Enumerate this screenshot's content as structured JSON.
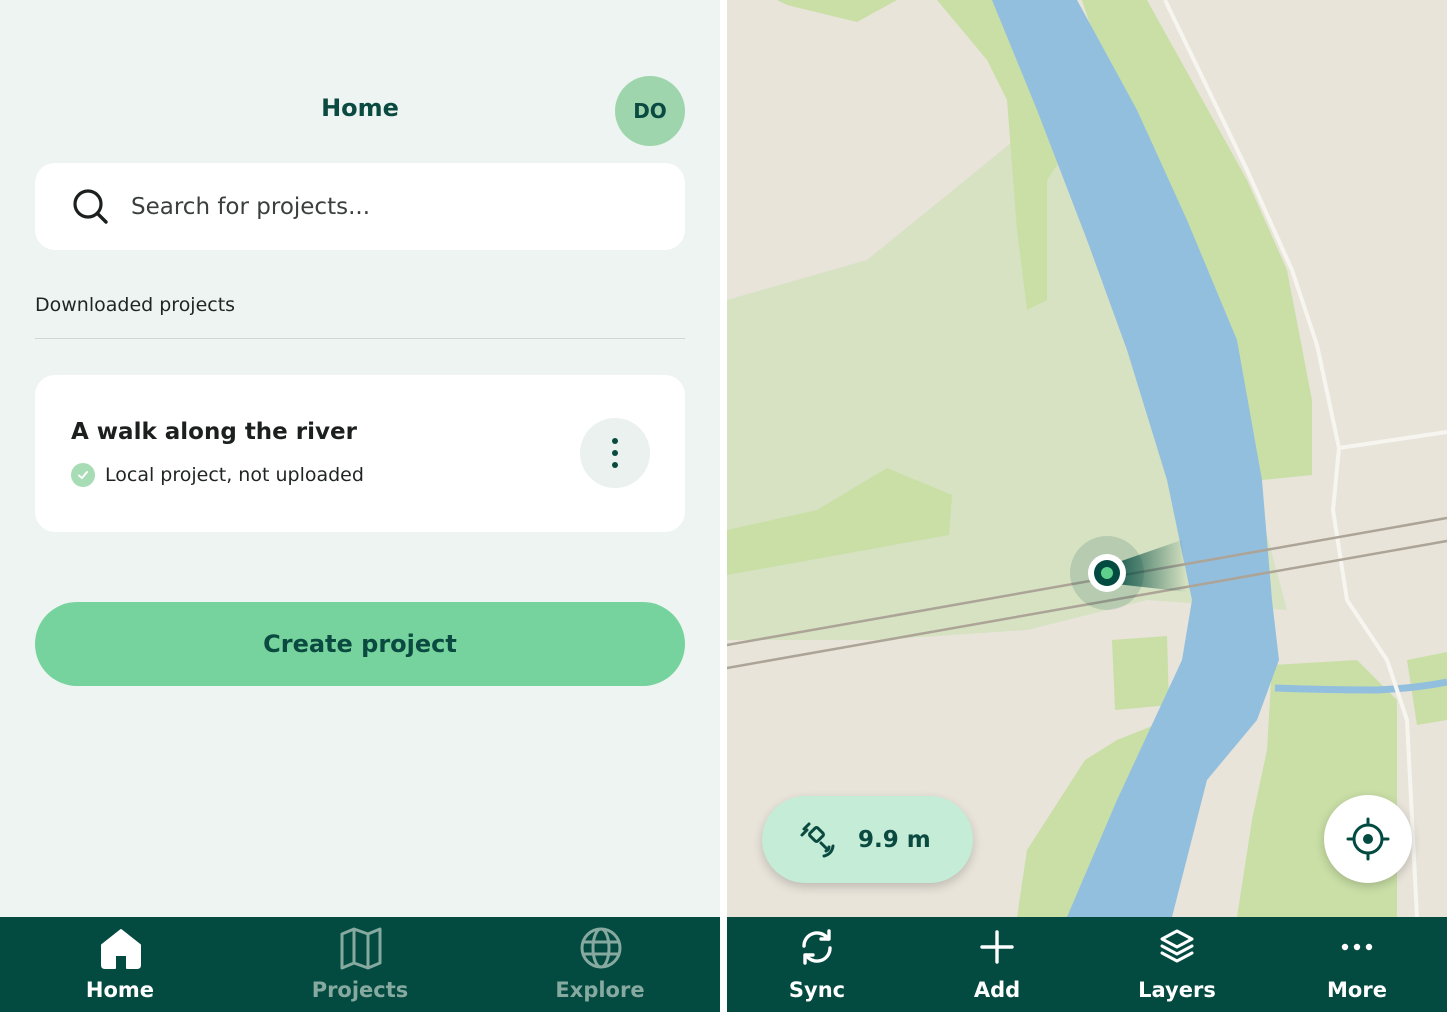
{
  "home": {
    "title": "Home",
    "avatar_initials": "DO",
    "search": {
      "placeholder": "Search for projects..."
    },
    "section_label": "Downloaded projects",
    "projects": [
      {
        "name": "A walk along the river",
        "status": "Local project, not uploaded",
        "status_icon": "check-circle-icon"
      }
    ],
    "create_button": "Create project",
    "nav": [
      {
        "label": "Home",
        "icon": "home-icon",
        "active": true
      },
      {
        "label": "Projects",
        "icon": "map-icon",
        "active": false
      },
      {
        "label": "Explore",
        "icon": "globe-icon",
        "active": false
      }
    ]
  },
  "map": {
    "gps_accuracy": "9.9 m",
    "gps_icon": "satellite-icon",
    "locate_icon": "crosshair-icon",
    "toolbar": [
      {
        "label": "Sync",
        "icon": "sync-icon"
      },
      {
        "label": "Add",
        "icon": "plus-icon"
      },
      {
        "label": "Layers",
        "icon": "layers-icon"
      },
      {
        "label": "More",
        "icon": "more-icon"
      }
    ]
  },
  "colors": {
    "brand_dark": "#034a40",
    "accent_green": "#76d39d",
    "avatar_bg": "#9ed5ad",
    "water": "#93bfdf",
    "vegetation": "#c9dfa6",
    "land": "#e8e4da"
  }
}
